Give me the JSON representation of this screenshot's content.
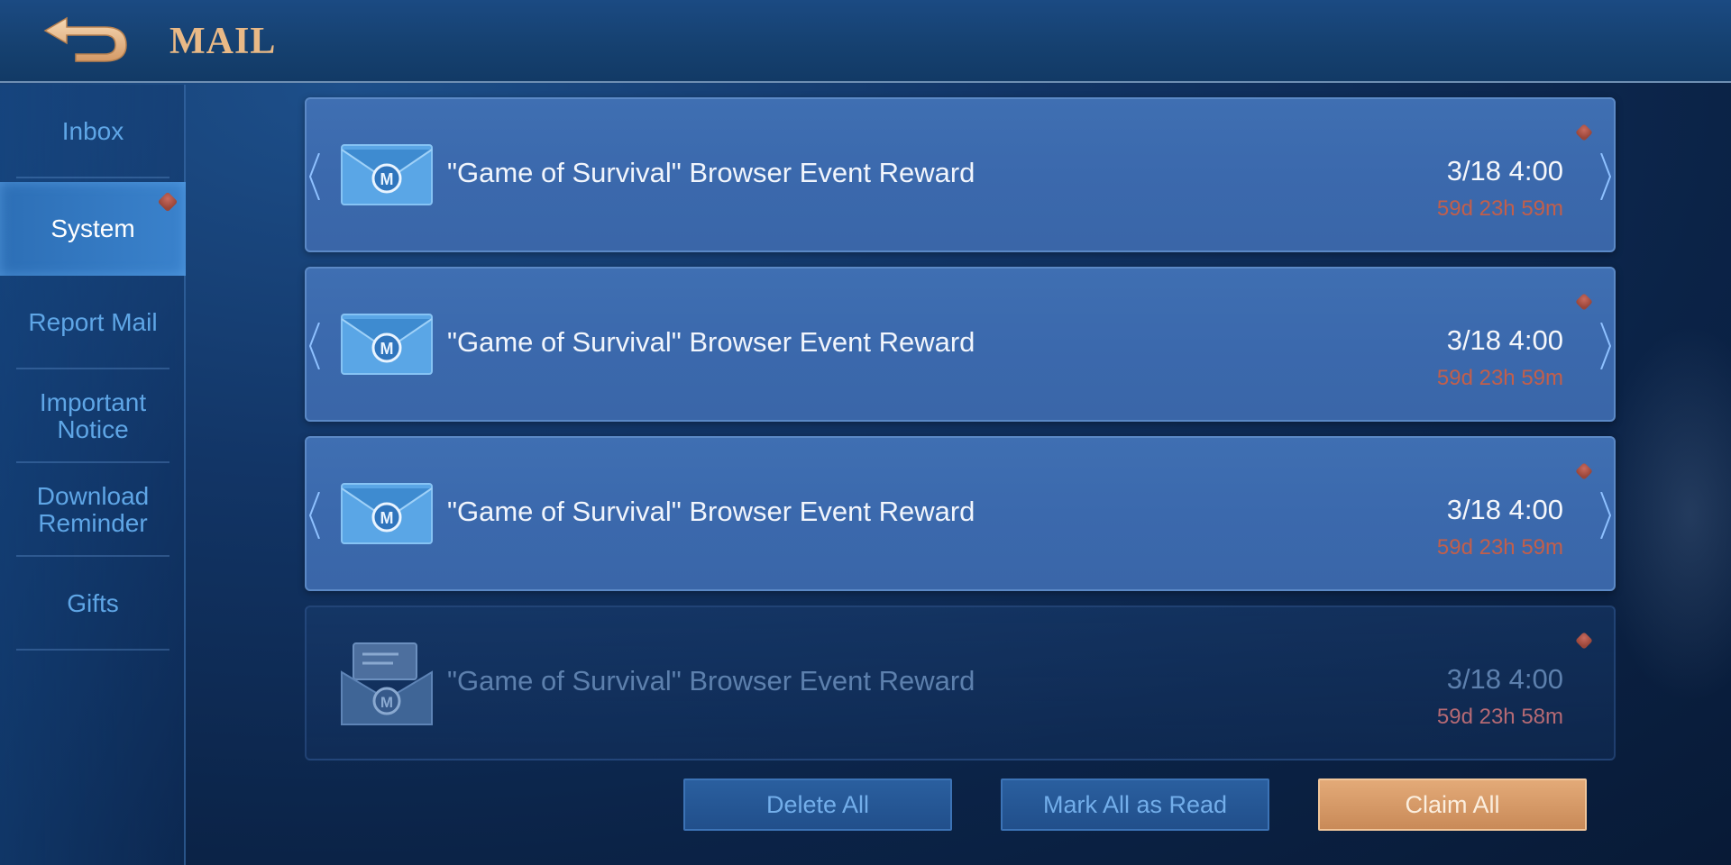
{
  "header": {
    "title": "MAIL",
    "back_icon": "back-arrow-icon",
    "title_color": "#e9b986"
  },
  "sidebar": {
    "items": [
      {
        "label": "Inbox",
        "active": false
      },
      {
        "label": "System",
        "active": true,
        "badge": true
      },
      {
        "label": "Report Mail",
        "active": false
      },
      {
        "label": "Important Notice",
        "active": false
      },
      {
        "label": "Download Reminder",
        "active": false
      },
      {
        "label": "Gifts",
        "active": false
      }
    ]
  },
  "mails": [
    {
      "subject": "\"Game of Survival\" Browser Event Reward",
      "date": "3/18 4:00",
      "expires": "59d 23h 59m",
      "read": false,
      "icon": "envelope-closed-icon"
    },
    {
      "subject": "\"Game of Survival\" Browser Event Reward",
      "date": "3/18 4:00",
      "expires": "59d 23h 59m",
      "read": false,
      "icon": "envelope-closed-icon"
    },
    {
      "subject": "\"Game of Survival\" Browser Event Reward",
      "date": "3/18 4:00",
      "expires": "59d 23h 59m",
      "read": false,
      "icon": "envelope-closed-icon"
    },
    {
      "subject": "\"Game of Survival\" Browser Event Reward",
      "date": "3/18 4:00",
      "expires": "59d 23h 58m",
      "read": true,
      "icon": "envelope-open-icon"
    }
  ],
  "actions": {
    "delete_all": "Delete All",
    "mark_all_read": "Mark All as Read",
    "claim_all": "Claim All"
  },
  "colors": {
    "accent_gold": "#e3aa78",
    "expire_red": "#c25f4b",
    "panel_blue": "#3f6fb2"
  }
}
